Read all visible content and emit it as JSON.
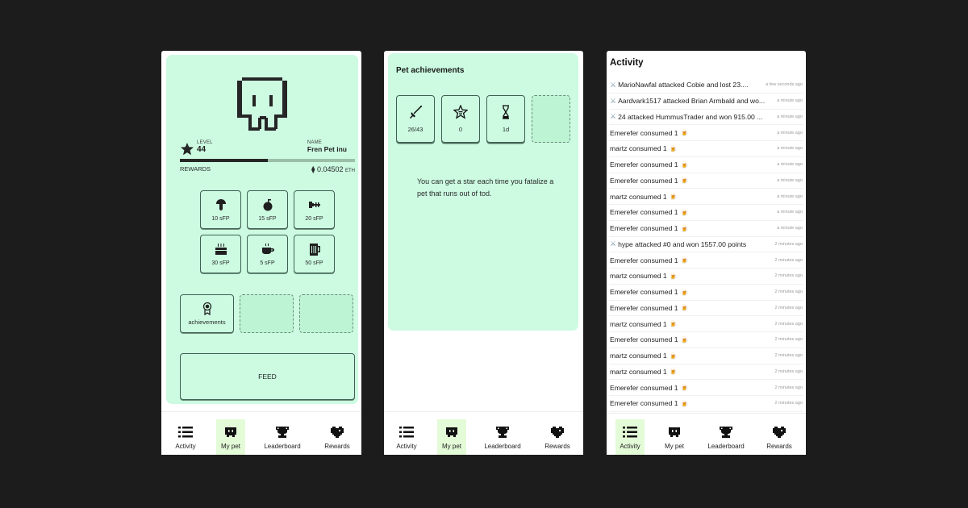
{
  "nav": {
    "items": [
      {
        "label": "Activity",
        "icon": "list-icon"
      },
      {
        "label": "My pet",
        "icon": "pet-icon"
      },
      {
        "label": "Leaderboard",
        "icon": "trophy-icon"
      },
      {
        "label": "Rewards",
        "icon": "heart-icon"
      }
    ]
  },
  "my_pet": {
    "level_label": "LEVEL",
    "level_value": "44",
    "name_label": "NAME",
    "name_value": "Fren Pet inu",
    "xp_progress_percent": 50,
    "rewards_label": "REWARDS",
    "rewards_value": "0.04502",
    "rewards_unit": "ETH",
    "foods": [
      {
        "icon": "mushroom-icon",
        "price": "10 sFP"
      },
      {
        "icon": "apple-icon",
        "price": "15 sFP"
      },
      {
        "icon": "fish-bone-icon",
        "price": "20 sFP"
      },
      {
        "icon": "cake-icon",
        "price": "30 sFP"
      },
      {
        "icon": "coffee-icon",
        "price": "5 sFP"
      },
      {
        "icon": "beer-icon",
        "price": "50 sFP"
      }
    ],
    "slots": [
      {
        "label": "achievements",
        "icon": "medal-icon"
      }
    ],
    "feed_label": "FEED",
    "active_tab": "My pet"
  },
  "achievements": {
    "title": "Pet achievements",
    "items": [
      {
        "icon": "sword-icon",
        "value": "26/43"
      },
      {
        "icon": "star-icon",
        "value": "0"
      },
      {
        "icon": "hourglass-icon",
        "value": "1d"
      }
    ],
    "description": "You can get a star each time you fatalize a pet that runs out of tod.",
    "active_tab": "My pet"
  },
  "activity": {
    "title": "Activity",
    "rows": [
      {
        "type": "attack",
        "text": "MarioNawfal attacked Cobie and lost 23....",
        "time": "a few seconds ago"
      },
      {
        "type": "attack",
        "text": "Aardvark1517 attacked Brian Armbald and wo...",
        "time": "a minute ago"
      },
      {
        "type": "attack",
        "text": "24 attacked HummusTrader and won 915.00 ...",
        "time": "a minute ago"
      },
      {
        "type": "consume",
        "text": "Emerefer consumed 1",
        "time": "a minute ago"
      },
      {
        "type": "consume",
        "text": "martz consumed 1",
        "time": "a minute ago"
      },
      {
        "type": "consume",
        "text": "Emerefer consumed 1",
        "time": "a minute ago"
      },
      {
        "type": "consume",
        "text": "Emerefer consumed 1",
        "time": "a minute ago"
      },
      {
        "type": "consume",
        "text": "martz consumed 1",
        "time": "a minute ago"
      },
      {
        "type": "consume",
        "text": "Emerefer consumed 1",
        "time": "a minute ago"
      },
      {
        "type": "consume",
        "text": "Emerefer consumed 1",
        "time": "a minute ago"
      },
      {
        "type": "attack",
        "text": "hype attacked #0 and won 1557.00 points",
        "time": "2 minutes ago"
      },
      {
        "type": "consume",
        "text": "Emerefer consumed 1",
        "time": "2 minutes ago"
      },
      {
        "type": "consume",
        "text": "martz consumed 1",
        "time": "2 minutes ago"
      },
      {
        "type": "consume",
        "text": "Emerefer consumed 1",
        "time": "2 minutes ago"
      },
      {
        "type": "consume",
        "text": "Emerefer consumed 1",
        "time": "2 minutes ago"
      },
      {
        "type": "consume",
        "text": "martz consumed 1",
        "time": "2 minutes ago"
      },
      {
        "type": "consume",
        "text": "Emerefer consumed 1",
        "time": "2 minutes ago"
      },
      {
        "type": "consume",
        "text": "martz consumed 1",
        "time": "2 minutes ago"
      },
      {
        "type": "consume",
        "text": "martz consumed 1",
        "time": "2 minutes ago"
      },
      {
        "type": "consume",
        "text": "Emerefer consumed 1",
        "time": "2 minutes ago"
      },
      {
        "type": "consume",
        "text": "Emerefer consumed 1",
        "time": "2 minutes ago"
      }
    ],
    "active_tab": "Activity"
  },
  "colors": {
    "panel": "#ccfbe1",
    "active_tab": "#e4fbd8",
    "background": "#1c1c1c"
  }
}
